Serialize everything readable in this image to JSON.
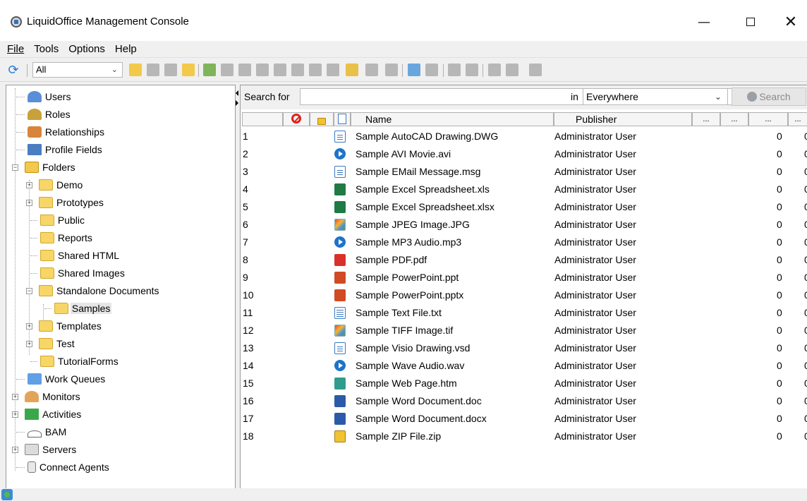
{
  "window": {
    "title": "LiquidOffice Management Console",
    "minimize": "—",
    "close": "✕"
  },
  "menu": [
    "File",
    "Tools",
    "Options",
    "Help"
  ],
  "toolbar": {
    "filter_value": "All",
    "refresh_icon": "refresh-icon"
  },
  "tree": {
    "items": [
      {
        "label": "Users",
        "icon": "users-icon"
      },
      {
        "label": "Roles",
        "icon": "roles-icon"
      },
      {
        "label": "Relationships",
        "icon": "relationships-icon"
      },
      {
        "label": "Profile Fields",
        "icon": "profile-fields-icon"
      },
      {
        "label": "Folders",
        "icon": "folders-icon"
      },
      {
        "label": "Demo",
        "icon": "folder-icon"
      },
      {
        "label": "Prototypes",
        "icon": "folder-icon"
      },
      {
        "label": "Public",
        "icon": "folder-icon"
      },
      {
        "label": "Reports",
        "icon": "folder-icon"
      },
      {
        "label": "Shared HTML",
        "icon": "folder-icon"
      },
      {
        "label": "Shared Images",
        "icon": "folder-icon"
      },
      {
        "label": "Standalone Documents",
        "icon": "folder-icon"
      },
      {
        "label": "Samples",
        "icon": "folder-icon"
      },
      {
        "label": "Templates",
        "icon": "folder-icon"
      },
      {
        "label": "Test",
        "icon": "folder-icon"
      },
      {
        "label": "TutorialForms",
        "icon": "folder-icon"
      },
      {
        "label": "Work Queues",
        "icon": "work-queues-icon"
      },
      {
        "label": "Monitors",
        "icon": "monitors-icon"
      },
      {
        "label": "Activities",
        "icon": "activities-icon"
      },
      {
        "label": "BAM",
        "icon": "bam-icon"
      },
      {
        "label": "Servers",
        "icon": "servers-icon"
      },
      {
        "label": "Connect Agents",
        "icon": "connect-agents-icon"
      }
    ],
    "selected": "Samples"
  },
  "search": {
    "label": "Search for",
    "value": "",
    "in_label": "in",
    "scope": "Everywhere",
    "button": "Search"
  },
  "grid": {
    "columns": [
      "Name",
      "Publisher",
      "...",
      "...",
      "...",
      "..."
    ],
    "rows": [
      {
        "num": "1",
        "name": "Sample AutoCAD Drawing.DWG",
        "publisher": "Administrator User",
        "count": "0",
        "type": "doc"
      },
      {
        "num": "2",
        "name": "Sample AVI Movie.avi",
        "publisher": "Administrator User",
        "count": "0",
        "type": "media"
      },
      {
        "num": "3",
        "name": "Sample EMail Message.msg",
        "publisher": "Administrator User",
        "count": "0",
        "type": "doc"
      },
      {
        "num": "4",
        "name": "Sample Excel Spreadsheet.xls",
        "publisher": "Administrator User",
        "count": "0",
        "type": "excel"
      },
      {
        "num": "5",
        "name": "Sample Excel Spreadsheet.xlsx",
        "publisher": "Administrator User",
        "count": "0",
        "type": "excel"
      },
      {
        "num": "6",
        "name": "Sample JPEG Image.JPG",
        "publisher": "Administrator User",
        "count": "0",
        "type": "img"
      },
      {
        "num": "7",
        "name": "Sample MP3 Audio.mp3",
        "publisher": "Administrator User",
        "count": "0",
        "type": "media"
      },
      {
        "num": "8",
        "name": "Sample PDF.pdf",
        "publisher": "Administrator User",
        "count": "0",
        "type": "pdf"
      },
      {
        "num": "9",
        "name": "Sample PowerPoint.ppt",
        "publisher": "Administrator User",
        "count": "0",
        "type": "ppt"
      },
      {
        "num": "10",
        "name": "Sample PowerPoint.pptx",
        "publisher": "Administrator User",
        "count": "0",
        "type": "ppt"
      },
      {
        "num": "11",
        "name": "Sample Text File.txt",
        "publisher": "Administrator User",
        "count": "0",
        "type": "txt"
      },
      {
        "num": "12",
        "name": "Sample TIFF Image.tif",
        "publisher": "Administrator User",
        "count": "0",
        "type": "img"
      },
      {
        "num": "13",
        "name": "Sample Visio Drawing.vsd",
        "publisher": "Administrator User",
        "count": "0",
        "type": "doc"
      },
      {
        "num": "14",
        "name": "Sample Wave Audio.wav",
        "publisher": "Administrator User",
        "count": "0",
        "type": "media"
      },
      {
        "num": "15",
        "name": "Sample Web Page.htm",
        "publisher": "Administrator User",
        "count": "0",
        "type": "web"
      },
      {
        "num": "16",
        "name": "Sample Word Document.doc",
        "publisher": "Administrator User",
        "count": "0",
        "type": "word"
      },
      {
        "num": "17",
        "name": "Sample Word Document.docx",
        "publisher": "Administrator User",
        "count": "0",
        "type": "word"
      },
      {
        "num": "18",
        "name": "Sample ZIP File.zip",
        "publisher": "Administrator User",
        "count": "0",
        "type": "zip"
      }
    ]
  },
  "colors": {
    "folder": "#f7d667",
    "chrome": "#f0f0f0",
    "border": "#9a9a9a",
    "selection": "#e6e6e6"
  }
}
